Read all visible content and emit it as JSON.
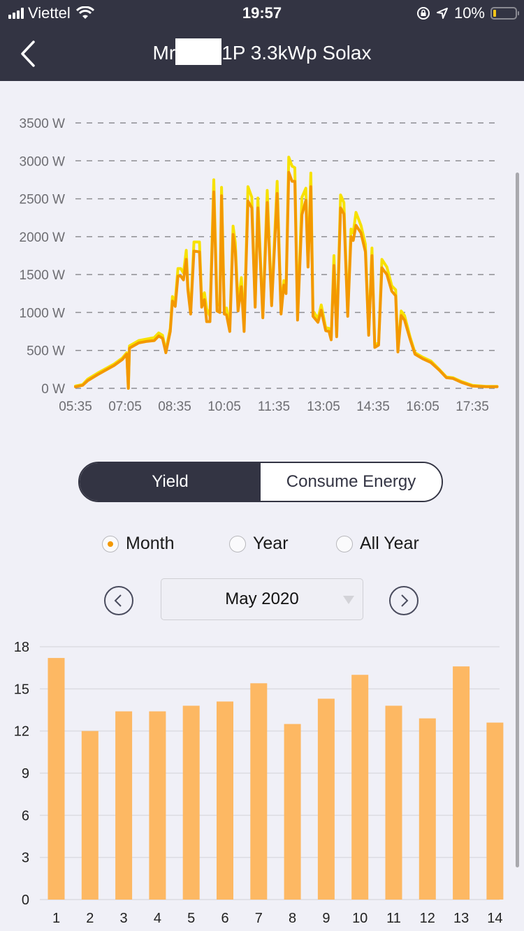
{
  "status_bar": {
    "carrier": "Viettel",
    "time": "19:57",
    "battery": "10%",
    "battery_level_percent": 10,
    "icons": [
      "signal-icon",
      "wifi-icon",
      "orientation-lock-icon",
      "location-icon",
      "battery-icon"
    ]
  },
  "nav": {
    "title_prefix": "Mr",
    "title_suffix": "1P 3.3kWp Solax",
    "back_icon": "chevron-left-icon"
  },
  "segment": {
    "options": [
      "Yield",
      "Consume Energy"
    ],
    "selected": "Yield"
  },
  "period": {
    "options": [
      "Month",
      "Year",
      "All Year"
    ],
    "selected": "Month"
  },
  "date_picker": {
    "value": "May 2020",
    "prev_icon": "chevron-left-circle-icon",
    "next_icon": "chevron-right-circle-icon"
  },
  "colors": {
    "header_bg": "#333443",
    "page_bg": "#f0f0f7",
    "series_primary": "#f39800",
    "series_secondary": "#f7e100",
    "bar": "#fdb863",
    "radio_selected": "#f39800"
  },
  "chart_data": [
    {
      "type": "line",
      "title": "",
      "xlabel": "",
      "ylabel": "",
      "y_unit": "W",
      "ylim": [
        0,
        3500
      ],
      "yticks": [
        "0 W",
        "500 W",
        "1000 W",
        "1500 W",
        "2000 W",
        "2500 W",
        "3000 W",
        "3500 W"
      ],
      "yticks_values": [
        0,
        500,
        1000,
        1500,
        2000,
        2500,
        3000,
        3500
      ],
      "xticks": [
        "05:35",
        "07:05",
        "08:35",
        "10:05",
        "11:35",
        "13:05",
        "14:35",
        "16:05",
        "17:35"
      ],
      "xlim_minutes": [
        335,
        1105
      ],
      "grid": "dashed-horizontal",
      "series": [
        {
          "name": "secondary",
          "color": "#f7e100",
          "points": [
            [
              "05:35",
              30
            ],
            [
              "05:48",
              50
            ],
            [
              "05:57",
              120
            ],
            [
              "06:15",
              200
            ],
            [
              "06:30",
              260
            ],
            [
              "06:45",
              320
            ],
            [
              "07:00",
              400
            ],
            [
              "07:08",
              470
            ],
            [
              "07:11",
              0
            ],
            [
              "07:13",
              560
            ],
            [
              "07:30",
              630
            ],
            [
              "07:45",
              650
            ],
            [
              "07:58",
              670
            ],
            [
              "08:06",
              730
            ],
            [
              "08:13",
              700
            ],
            [
              "08:19",
              500
            ],
            [
              "08:27",
              790
            ],
            [
              "08:31",
              1210
            ],
            [
              "08:36",
              1150
            ],
            [
              "08:41",
              1580
            ],
            [
              "08:46",
              1580
            ],
            [
              "08:51",
              1520
            ],
            [
              "08:56",
              1820
            ],
            [
              "08:59",
              1350
            ],
            [
              "09:04",
              1020
            ],
            [
              "09:10",
              1930
            ],
            [
              "09:20",
              1930
            ],
            [
              "09:24",
              1150
            ],
            [
              "09:29",
              1260
            ],
            [
              "09:33",
              1050
            ],
            [
              "09:39",
              950
            ],
            [
              "09:46",
              2750
            ],
            [
              "09:52",
              1100
            ],
            [
              "09:57",
              1100
            ],
            [
              "10:00",
              2650
            ],
            [
              "10:05",
              1050
            ],
            [
              "10:09",
              1060
            ],
            [
              "10:15",
              800
            ],
            [
              "10:21",
              2140
            ],
            [
              "10:25",
              1920
            ],
            [
              "10:30",
              1100
            ],
            [
              "10:36",
              1460
            ],
            [
              "10:41",
              800
            ],
            [
              "10:48",
              2660
            ],
            [
              "10:55",
              2520
            ],
            [
              "11:01",
              1100
            ],
            [
              "11:06",
              2510
            ],
            [
              "11:15",
              960
            ],
            [
              "11:23",
              2610
            ],
            [
              "11:31",
              1130
            ],
            [
              "11:41",
              2730
            ],
            [
              "11:48",
              1020
            ],
            [
              "11:53",
              1420
            ],
            [
              "11:57",
              1300
            ],
            [
              "12:02",
              3050
            ],
            [
              "12:08",
              2930
            ],
            [
              "12:13",
              2910
            ],
            [
              "12:18",
              950
            ],
            [
              "12:26",
              2520
            ],
            [
              "12:33",
              2640
            ],
            [
              "12:37",
              1600
            ],
            [
              "12:42",
              2840
            ],
            [
              "12:46",
              1020
            ],
            [
              "12:55",
              920
            ],
            [
              "13:01",
              1100
            ],
            [
              "13:09",
              800
            ],
            [
              "13:15",
              790
            ],
            [
              "13:19",
              660
            ],
            [
              "13:24",
              1750
            ],
            [
              "13:29",
              700
            ],
            [
              "13:36",
              2550
            ],
            [
              "13:42",
              2450
            ],
            [
              "13:49",
              1000
            ],
            [
              "13:55",
              2100
            ],
            [
              "13:59",
              2050
            ],
            [
              "14:04",
              2320
            ],
            [
              "14:13",
              2150
            ],
            [
              "14:21",
              1900
            ],
            [
              "14:27",
              720
            ],
            [
              "14:33",
              1850
            ],
            [
              "14:38",
              570
            ],
            [
              "14:45",
              600
            ],
            [
              "14:51",
              1700
            ],
            [
              "15:00",
              1600
            ],
            [
              "15:09",
              1350
            ],
            [
              "15:16",
              1300
            ],
            [
              "15:20",
              500
            ],
            [
              "15:26",
              1020
            ],
            [
              "15:32",
              960
            ],
            [
              "15:42",
              680
            ],
            [
              "15:51",
              470
            ],
            [
              "16:05",
              410
            ],
            [
              "16:20",
              360
            ],
            [
              "16:35",
              250
            ],
            [
              "16:48",
              150
            ],
            [
              "17:00",
              140
            ],
            [
              "17:15",
              90
            ],
            [
              "17:35",
              40
            ],
            [
              "18:00",
              25
            ],
            [
              "18:20",
              25
            ]
          ]
        },
        {
          "name": "primary",
          "color": "#f39800",
          "points": [
            [
              "05:35",
              20
            ],
            [
              "05:48",
              40
            ],
            [
              "05:57",
              100
            ],
            [
              "06:15",
              180
            ],
            [
              "06:30",
              240
            ],
            [
              "06:45",
              300
            ],
            [
              "07:00",
              380
            ],
            [
              "07:08",
              450
            ],
            [
              "07:11",
              0
            ],
            [
              "07:13",
              530
            ],
            [
              "07:30",
              600
            ],
            [
              "07:45",
              620
            ],
            [
              "07:58",
              630
            ],
            [
              "08:06",
              690
            ],
            [
              "08:13",
              660
            ],
            [
              "08:19",
              470
            ],
            [
              "08:27",
              750
            ],
            [
              "08:31",
              1150
            ],
            [
              "08:36",
              1080
            ],
            [
              "08:41",
              1480
            ],
            [
              "08:46",
              1480
            ],
            [
              "08:51",
              1430
            ],
            [
              "08:56",
              1700
            ],
            [
              "08:59",
              1300
            ],
            [
              "09:04",
              980
            ],
            [
              "09:10",
              1810
            ],
            [
              "09:20",
              1800
            ],
            [
              "09:24",
              1070
            ],
            [
              "09:29",
              1170
            ],
            [
              "09:33",
              880
            ],
            [
              "09:39",
              880
            ],
            [
              "09:46",
              2590
            ],
            [
              "09:52",
              1020
            ],
            [
              "09:57",
              1000
            ],
            [
              "10:00",
              2540
            ],
            [
              "10:05",
              980
            ],
            [
              "10:09",
              970
            ],
            [
              "10:15",
              750
            ],
            [
              "10:21",
              2030
            ],
            [
              "10:25",
              1800
            ],
            [
              "10:30",
              1020
            ],
            [
              "10:36",
              1340
            ],
            [
              "10:41",
              750
            ],
            [
              "10:48",
              2470
            ],
            [
              "10:55",
              2380
            ],
            [
              "11:01",
              1070
            ],
            [
              "11:06",
              2380
            ],
            [
              "11:15",
              930
            ],
            [
              "11:23",
              2450
            ],
            [
              "11:31",
              1090
            ],
            [
              "11:41",
              2570
            ],
            [
              "11:48",
              980
            ],
            [
              "11:53",
              1360
            ],
            [
              "11:57",
              1250
            ],
            [
              "12:02",
              2850
            ],
            [
              "12:08",
              2730
            ],
            [
              "12:13",
              2730
            ],
            [
              "12:18",
              900
            ],
            [
              "12:26",
              2290
            ],
            [
              "12:33",
              2480
            ],
            [
              "12:37",
              1600
            ],
            [
              "12:42",
              2660
            ],
            [
              "12:46",
              950
            ],
            [
              "12:55",
              870
            ],
            [
              "13:01",
              1030
            ],
            [
              "13:09",
              760
            ],
            [
              "13:15",
              750
            ],
            [
              "13:19",
              640
            ],
            [
              "13:24",
              1620
            ],
            [
              "13:29",
              680
            ],
            [
              "13:36",
              2380
            ],
            [
              "13:42",
              2300
            ],
            [
              "13:49",
              950
            ],
            [
              "13:55",
              2000
            ],
            [
              "13:59",
              1950
            ],
            [
              "14:04",
              2150
            ],
            [
              "14:13",
              2050
            ],
            [
              "14:21",
              1800
            ],
            [
              "14:27",
              700
            ],
            [
              "14:33",
              1750
            ],
            [
              "14:38",
              540
            ],
            [
              "14:45",
              570
            ],
            [
              "14:51",
              1590
            ],
            [
              "15:00",
              1500
            ],
            [
              "15:09",
              1280
            ],
            [
              "15:16",
              1220
            ],
            [
              "15:20",
              480
            ],
            [
              "15:26",
              960
            ],
            [
              "15:32",
              900
            ],
            [
              "15:42",
              650
            ],
            [
              "15:51",
              450
            ],
            [
              "16:05",
              390
            ],
            [
              "16:20",
              340
            ],
            [
              "16:35",
              240
            ],
            [
              "16:48",
              140
            ],
            [
              "17:00",
              130
            ],
            [
              "17:15",
              80
            ],
            [
              "17:35",
              30
            ],
            [
              "18:00",
              20
            ],
            [
              "18:20",
              20
            ]
          ]
        }
      ]
    },
    {
      "type": "bar",
      "title": "",
      "xlabel": "",
      "ylabel": "",
      "categories": [
        "1",
        "2",
        "3",
        "4",
        "5",
        "6",
        "7",
        "8",
        "9",
        "10",
        "11",
        "12",
        "13",
        "14"
      ],
      "values": [
        17.2,
        12.0,
        13.4,
        13.4,
        13.8,
        14.1,
        15.4,
        12.5,
        14.3,
        16.0,
        13.8,
        12.9,
        16.6,
        12.6
      ],
      "ylim": [
        0,
        18
      ],
      "yticks": [
        "0",
        "3",
        "6",
        "9",
        "12",
        "15",
        "18"
      ],
      "yticks_values": [
        0,
        3,
        6,
        9,
        12,
        15,
        18
      ],
      "grid": "solid-horizontal",
      "color": "#fdb863"
    }
  ]
}
